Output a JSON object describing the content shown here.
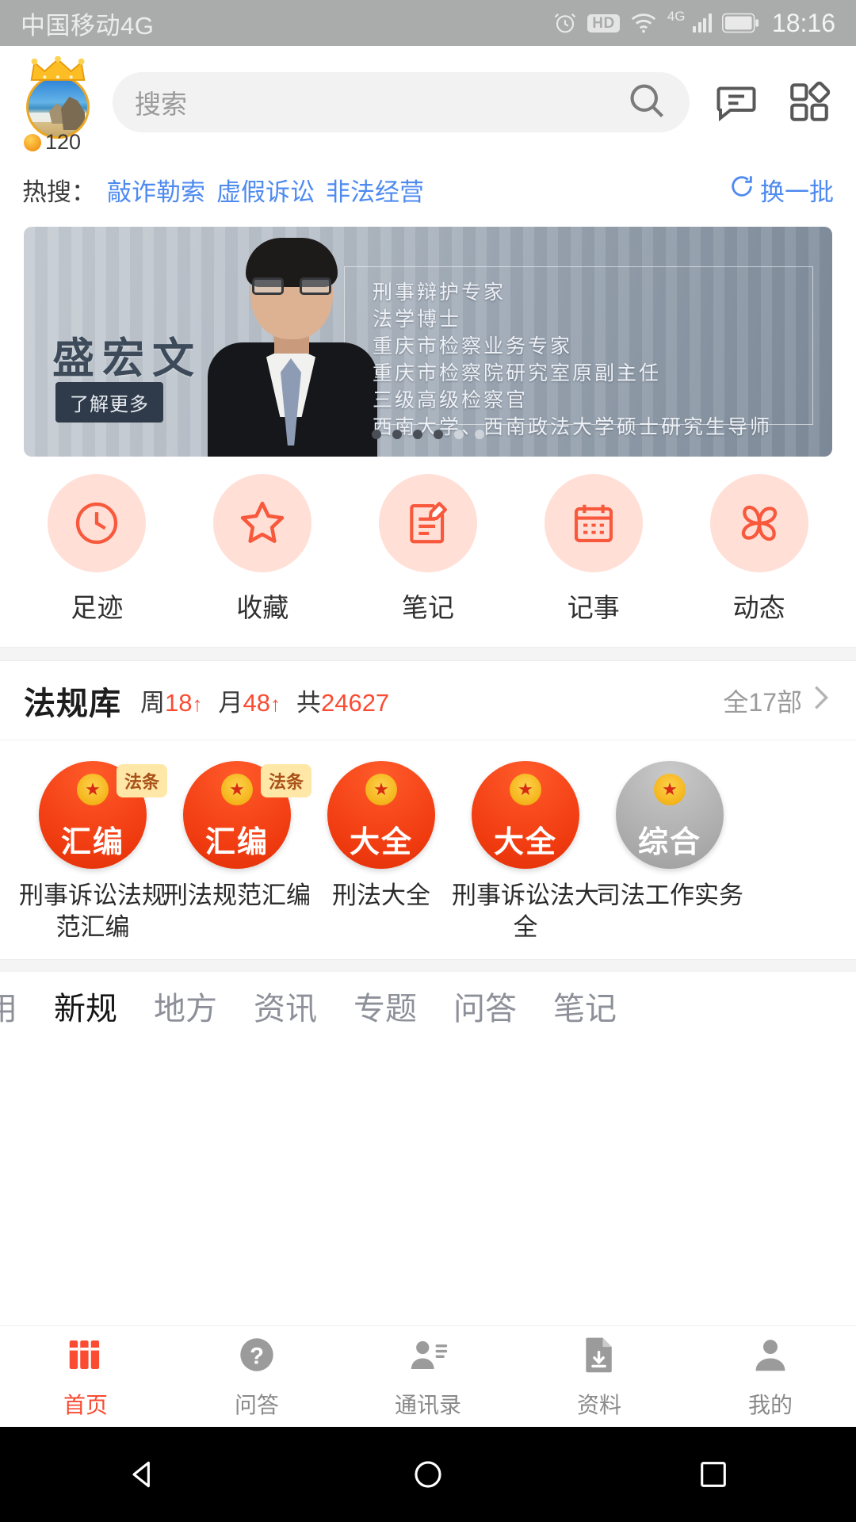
{
  "status_bar": {
    "carrier": "中国移动4G",
    "hd_label": "HD",
    "network_label": "4G",
    "time": "18:16",
    "icons": [
      "alarm-icon",
      "hd-icon",
      "wifi-icon",
      "signal-icon",
      "battery-icon"
    ]
  },
  "header": {
    "coin_count": "120",
    "search_placeholder": "搜索",
    "icons": [
      "search-icon",
      "message-icon",
      "grid-icon"
    ]
  },
  "hot_search": {
    "label": "热搜：",
    "tags": [
      "敲诈勒索",
      "虚假诉讼",
      "非法经营"
    ],
    "refresh_label": "换一批"
  },
  "banner": {
    "name": "盛宏文",
    "more_label": "了解更多",
    "credentials": [
      "刑事辩护专家",
      "法学博士",
      "重庆市检察业务专家",
      "重庆市检察院研究室原副主任",
      "三级高级检察官",
      "西南大学、西南政法大学硕士研究生导师"
    ],
    "dot_count": 6,
    "active_dots": 4
  },
  "quick_actions": [
    {
      "label": "足迹",
      "icon": "clock-icon"
    },
    {
      "label": "收藏",
      "icon": "star-icon"
    },
    {
      "label": "笔记",
      "icon": "note-edit-icon"
    },
    {
      "label": "记事",
      "icon": "calendar-icon"
    },
    {
      "label": "动态",
      "icon": "fan-icon"
    }
  ],
  "law_library": {
    "title": "法规库",
    "week_label": "周",
    "week_value": "18",
    "month_label": "月",
    "month_value": "48",
    "total_label": "共",
    "total_value": "24627",
    "all_label": "全17部"
  },
  "books": [
    {
      "word": "汇编",
      "tag": "法条",
      "name": "刑事诉讼法规范汇编",
      "grey": false
    },
    {
      "word": "汇编",
      "tag": "法条",
      "name": "刑法规范汇编",
      "grey": false
    },
    {
      "word": "大全",
      "tag": "",
      "name": "刑法大全",
      "grey": false
    },
    {
      "word": "大全",
      "tag": "",
      "name": "刑事诉讼法大全",
      "grey": false
    },
    {
      "word": "综合",
      "tag": "",
      "name": "司法工作实务",
      "grey": true
    }
  ],
  "categories": [
    {
      "label": "用",
      "active": false
    },
    {
      "label": "新规",
      "active": true
    },
    {
      "label": "地方",
      "active": false
    },
    {
      "label": "资讯",
      "active": false
    },
    {
      "label": "专题",
      "active": false
    },
    {
      "label": "问答",
      "active": false
    },
    {
      "label": "笔记",
      "active": false
    }
  ],
  "bottom_nav": [
    {
      "label": "首页",
      "icon": "books-icon",
      "active": true
    },
    {
      "label": "问答",
      "icon": "question-icon",
      "active": false
    },
    {
      "label": "通讯录",
      "icon": "contacts-icon",
      "active": false
    },
    {
      "label": "资料",
      "icon": "document-download-icon",
      "active": false
    },
    {
      "label": "我的",
      "icon": "person-icon",
      "active": false
    }
  ],
  "android_nav": [
    "back-icon",
    "home-icon",
    "recents-icon"
  ],
  "colors": {
    "accent": "#fa4b33",
    "link": "#4e8af0",
    "coin": "#f2981a"
  }
}
